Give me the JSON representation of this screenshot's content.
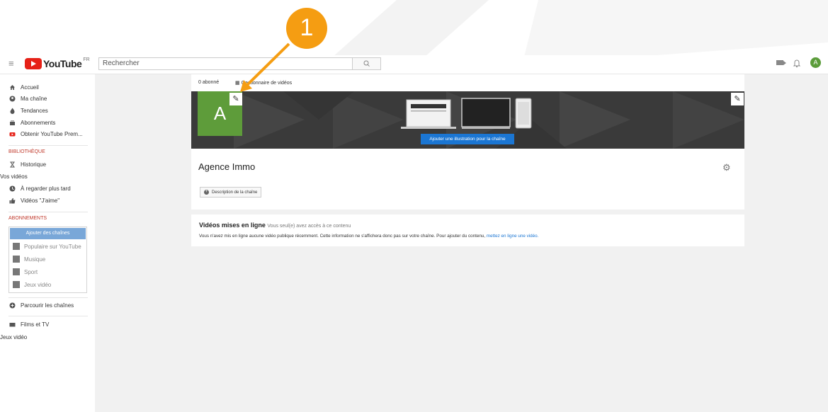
{
  "colors": {
    "accent_blue": "#1b76d3",
    "youtube_red": "#e62117",
    "annotation_orange": "#f59d12",
    "avatar_green": "#5e9c3a"
  },
  "annotation": {
    "step_number": "1"
  },
  "header": {
    "logo_word": "YouTube",
    "logo_region": "FR",
    "search_placeholder": "Rechercher",
    "avatar_letter": "A"
  },
  "sidebar": {
    "main_items": [
      {
        "label": "Accueil",
        "icon": "home-icon"
      },
      {
        "label": "Ma chaîne",
        "icon": "account-icon"
      },
      {
        "label": "Tendances",
        "icon": "flame-icon"
      },
      {
        "label": "Abonnements",
        "icon": "subscriptions-icon"
      },
      {
        "label": "Obtenir YouTube Prem...",
        "icon": "youtube-premium-icon"
      }
    ],
    "library_header": "BIBLIOTHÈQUE",
    "library_items": [
      {
        "label": "Historique",
        "icon": "hourglass-icon"
      },
      {
        "label": "Vos vidéos",
        "icon": ""
      },
      {
        "label": "À regarder plus tard",
        "icon": "clock-icon"
      },
      {
        "label": "Vidéos \"J'aime\"",
        "icon": "thumb-up-icon"
      }
    ],
    "subscriptions_header": "ABONNEMENTS",
    "add_channels": "Ajouter des chaînes",
    "sub_items": [
      {
        "label": "Populaire sur YouTube"
      },
      {
        "label": "Musique"
      },
      {
        "label": "Sport"
      },
      {
        "label": "Jeux vidéo"
      }
    ],
    "browse_channels": "Parcourir les chaînes",
    "movies_tv": "Films et TV",
    "gaming": "Jeux vidéo"
  },
  "channel": {
    "subscribers": "0 abonné",
    "video_manager": "Gestionnaire de vidéos",
    "avatar_letter": "A",
    "add_art_button": "Ajouter une illustration pour la chaîne",
    "name": "Agence Immo",
    "description_button": "Description de la chaîne"
  },
  "uploads": {
    "title": "Vidéos mises en ligne",
    "visibility": "Vous seul(e) avez accès à ce contenu",
    "message": "Vous n'avez mis en ligne aucune vidéo publique récemment. Cette information ne s'affichera donc pas sur votre chaîne. Pour ajouter du contenu,",
    "link": "mettez en ligne une vidéo."
  }
}
